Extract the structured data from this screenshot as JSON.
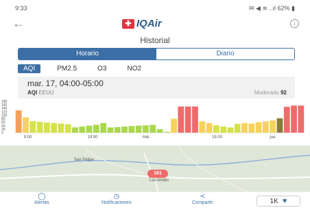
{
  "status_bar": {
    "time": "9:33",
    "right": "✉ ◀ ≋ ..ıl 62% ▮"
  },
  "app": {
    "back_glyph": "←",
    "logo_mark": "✚",
    "logo_text": "IQAir",
    "info_glyph": "i"
  },
  "page": {
    "title": "Historial"
  },
  "segments": [
    {
      "label": "Horario",
      "active": true
    },
    {
      "label": "Diario",
      "active": false
    }
  ],
  "pollutants": [
    {
      "label": "AQI",
      "active": true
    },
    {
      "label": "PM2.5"
    },
    {
      "label": "O3"
    },
    {
      "label": "NO2"
    }
  ],
  "selection": {
    "datetime": "mar. 17, 04:00-05:00",
    "aqi_prefix": "AQI",
    "region": "EEUU",
    "level": "Moderado",
    "value": "92"
  },
  "chart_data": {
    "type": "bar",
    "ylim": [
      0,
      180
    ],
    "y_ticks": [
      "180",
      "160",
      "140",
      "120",
      "100",
      "80",
      "60",
      "40",
      "20",
      "0"
    ],
    "x_ticks": [
      "9:00",
      "19:00",
      "mié.",
      "15:00",
      "jue."
    ],
    "values": [
      128,
      88,
      66,
      62,
      58,
      55,
      52,
      48,
      30,
      35,
      40,
      45,
      55,
      30,
      32,
      35,
      38,
      40,
      42,
      45,
      20,
      5,
      80,
      150,
      150,
      150,
      65,
      55,
      42,
      35,
      30,
      50,
      55,
      52,
      60,
      65,
      70,
      82,
      148,
      155,
      155
    ],
    "colors": [
      "#f5a05a",
      "#f7d25b",
      "#d6e24a",
      "#d6e24a",
      "#d6e24a",
      "#d6e24a",
      "#d6e24a",
      "#d6e24a",
      "#a9d84c",
      "#a9d84c",
      "#a9d84c",
      "#a9d84c",
      "#a9d84c",
      "#a9d84c",
      "#a9d84c",
      "#a9d84c",
      "#a9d84c",
      "#a9d84c",
      "#a9d84c",
      "#a9d84c",
      "#a9d84c",
      "#a9d84c",
      "#f7d25b",
      "#ef6b6b",
      "#ef6b6b",
      "#ef6b6b",
      "#f7d25b",
      "#f7d25b",
      "#d6e24a",
      "#d6e24a",
      "#d6e24a",
      "#d6e24a",
      "#f7d25b",
      "#f7d25b",
      "#f7d25b",
      "#f7d25b",
      "#f7d25b",
      "#8a7a3a",
      "#ef6b6b",
      "#ef6b6b",
      "#ef6b6b"
    ]
  },
  "map": {
    "labels": [
      "San Felipe",
      "Los Andes"
    ],
    "badge": "161"
  },
  "bottom_nav": [
    {
      "label": "Alertas",
      "icon": "bell-icon",
      "glyph": "◯"
    },
    {
      "label": "Notificaciones",
      "icon": "clock-icon",
      "glyph": "◷"
    },
    {
      "label": "Compartir",
      "icon": "share-icon",
      "glyph": "≺"
    }
  ],
  "like": {
    "count": "1K",
    "glyph": "♥"
  },
  "colors": {
    "brand": "#3b6fa5",
    "red": "#e03440"
  }
}
